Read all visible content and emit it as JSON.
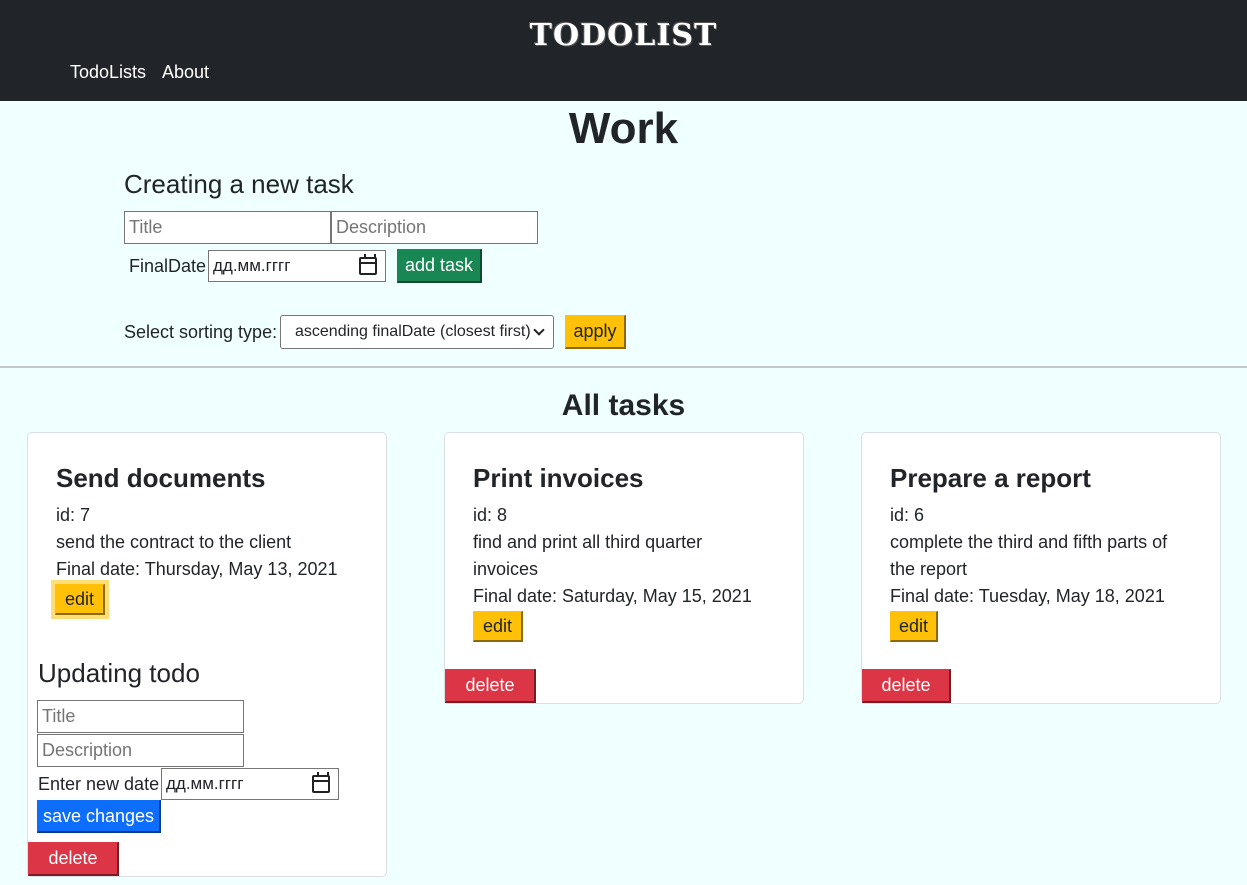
{
  "header": {
    "brand": "TODOLIST",
    "nav": [
      "TodoLists",
      "About"
    ]
  },
  "page_title": "Work",
  "create_form": {
    "heading": "Creating a new task",
    "title_placeholder": "Title",
    "description_placeholder": "Description",
    "final_date_label": "FinalDate",
    "date_placeholder": "дд.мм.гггг",
    "add_button": "add task"
  },
  "sorting": {
    "label": "Select sorting type:",
    "selected": "ascending finalDate (closest first)",
    "apply_button": "apply"
  },
  "all_tasks_heading": "All tasks",
  "tasks": [
    {
      "title": "Send documents",
      "id": "id: 7",
      "description": "send the contract to the client",
      "final_date": "Final date: Thursday, May 13, 2021",
      "edit": "edit",
      "delete": "delete"
    },
    {
      "title": "Print invoices",
      "id": "id: 8",
      "description_1": "find and print all third quarter",
      "description_2": "invoices",
      "final_date": "Final date: Saturday, May 15, 2021",
      "edit": "edit",
      "delete": "delete"
    },
    {
      "title": "Prepare a report",
      "id": "id: 6",
      "description_1": "complete the third and fifth parts of",
      "description_2": "the report",
      "final_date": "Final date: Tuesday, May 18, 2021",
      "edit": "edit",
      "delete": "delete"
    }
  ],
  "update_form": {
    "heading": "Updating todo",
    "title_placeholder": "Title",
    "description_placeholder": "Description",
    "date_label": "Enter new date",
    "date_placeholder": "дд.мм.гггг",
    "save_button": "save changes"
  },
  "colors": {
    "navbar": "#212529",
    "page_bg": "#f0ffff",
    "success": "#198754",
    "warning": "#ffc107",
    "danger": "#dc3545",
    "primary": "#0d6efd"
  }
}
